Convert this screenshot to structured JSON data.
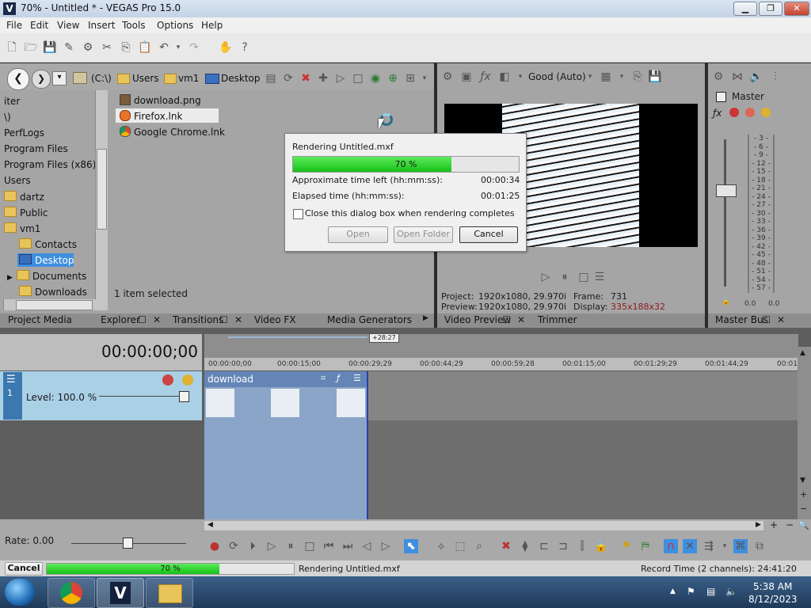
{
  "window": {
    "title": "70% - Untitled * - VEGAS Pro 15.0",
    "logo": "V"
  },
  "menu": [
    "File",
    "Edit",
    "View",
    "Insert",
    "Tools",
    "Options",
    "Help"
  ],
  "explorer": {
    "crumbs": [
      "(C:\\)",
      "Users",
      "vm1",
      "Desktop"
    ],
    "tree": [
      "iter",
      "\\)",
      "PerfLogs",
      "Program Files",
      "Program Files (x86)",
      "Users",
      "dartz",
      "Public",
      "vm1",
      "Contacts",
      "Desktop",
      "Documents",
      "Downloads"
    ],
    "files": [
      "download.png",
      "Firefox.lnk",
      "Google Chrome.lnk"
    ],
    "status": "1 item selected"
  },
  "preview": {
    "quality": "Good (Auto)",
    "project_label": "Project:",
    "project_value": "1920x1080, 29.970i",
    "preview_label": "Preview:",
    "preview_value": "1920x1080, 29.970i",
    "frame_label": "Frame:",
    "frame_value": "731",
    "display_label": "Display:",
    "display_value": "335x188x32"
  },
  "master": {
    "label": "Master",
    "scale": [
      "3",
      "6",
      "9",
      "12",
      "15",
      "18",
      "21",
      "24",
      "27",
      "30",
      "33",
      "36",
      "39",
      "42",
      "45",
      "48",
      "51",
      "54",
      "57"
    ],
    "left_val": "0.0",
    "right_val": "0.0"
  },
  "tabs": {
    "left": [
      "Project Media",
      "Explorer",
      "Transitions",
      "Video FX",
      "Media Generators"
    ],
    "preview": [
      "Video Preview",
      "Trimmer"
    ],
    "master": "Master Bus"
  },
  "timeline": {
    "timecode": "00:00:00;00",
    "marker": "+28:27",
    "ruler": [
      "00:00:00;00",
      "00:00:15;00",
      "00:00:29;29",
      "00:00:44;29",
      "00:00:59;28",
      "00:01:15;00",
      "00:01:29;29",
      "00:01:44;29",
      "00:01"
    ],
    "track_level": "Level: 100.0 %",
    "track_number": "1",
    "clip_name": "download",
    "rate": "Rate: 0.00"
  },
  "status": {
    "cancel": "Cancel",
    "progress_text": "70 %",
    "progress": 0.7,
    "message": "Rendering Untitled.mxf",
    "record_time": "Record Time (2 channels): 24:41:20"
  },
  "dialog": {
    "title": "Rendering Untitled.mxf",
    "progress_text": "70 %",
    "progress": 0.7,
    "time_left_label": "Approximate time left (hh:mm:ss):",
    "time_left": "00:00:34",
    "elapsed_label": "Elapsed time (hh:mm:ss):",
    "elapsed": "00:01:25",
    "checkbox_label": "Close this dialog box when rendering completes",
    "open": "Open",
    "open_folder": "Open Folder",
    "cancel": "Cancel"
  },
  "taskbar": {
    "time": "5:38 AM",
    "date": "8/12/2023"
  }
}
